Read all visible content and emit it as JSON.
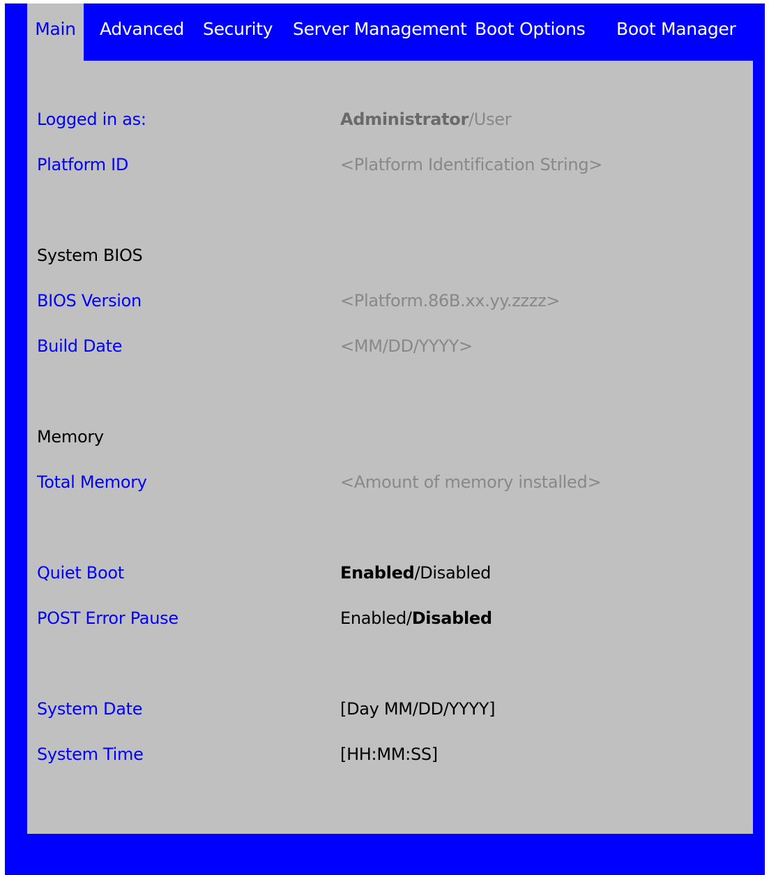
{
  "tabs": [
    {
      "label": "Main",
      "active": true
    },
    {
      "label": "Advanced",
      "active": false
    },
    {
      "label": "Security",
      "active": false
    },
    {
      "label": "Server Management",
      "active": false
    },
    {
      "label": "Boot Options",
      "active": false
    },
    {
      "label": "Boot Manager",
      "active": false
    }
  ],
  "main": {
    "logged_in": {
      "label": "Logged in as:",
      "current": "Administrator",
      "separator": "/",
      "other": "User"
    },
    "platform_id": {
      "label": "Platform ID",
      "value": "<Platform Identification String>"
    },
    "system_bios": {
      "heading": "System BIOS"
    },
    "bios_version": {
      "label": "BIOS Version",
      "value": "<Platform.86B.xx.yy.zzzz>"
    },
    "build_date": {
      "label": "Build Date",
      "value": "<MM/DD/YYYY>"
    },
    "memory": {
      "heading": "Memory"
    },
    "total_memory": {
      "label": "Total Memory",
      "value": "<Amount of memory installed>"
    },
    "quiet_boot": {
      "label": "Quiet Boot",
      "option_a": "Enabled",
      "separator": "/",
      "option_b": "Disabled",
      "selected": "Enabled"
    },
    "post_error_pause": {
      "label": "POST Error Pause",
      "option_a": "Enabled",
      "separator": "/",
      "option_b": "Disabled",
      "selected": "Disabled"
    },
    "system_date": {
      "label": "System Date",
      "value": "[Day MM/DD/YYYY]"
    },
    "system_time": {
      "label": "System Time",
      "value": "[HH:MM:SS]"
    }
  },
  "colors": {
    "frame": "#0000ff",
    "panel": "#c0c0c0",
    "label": "#0000ff",
    "readonly_value": "#888888",
    "editable_value": "#000000"
  }
}
